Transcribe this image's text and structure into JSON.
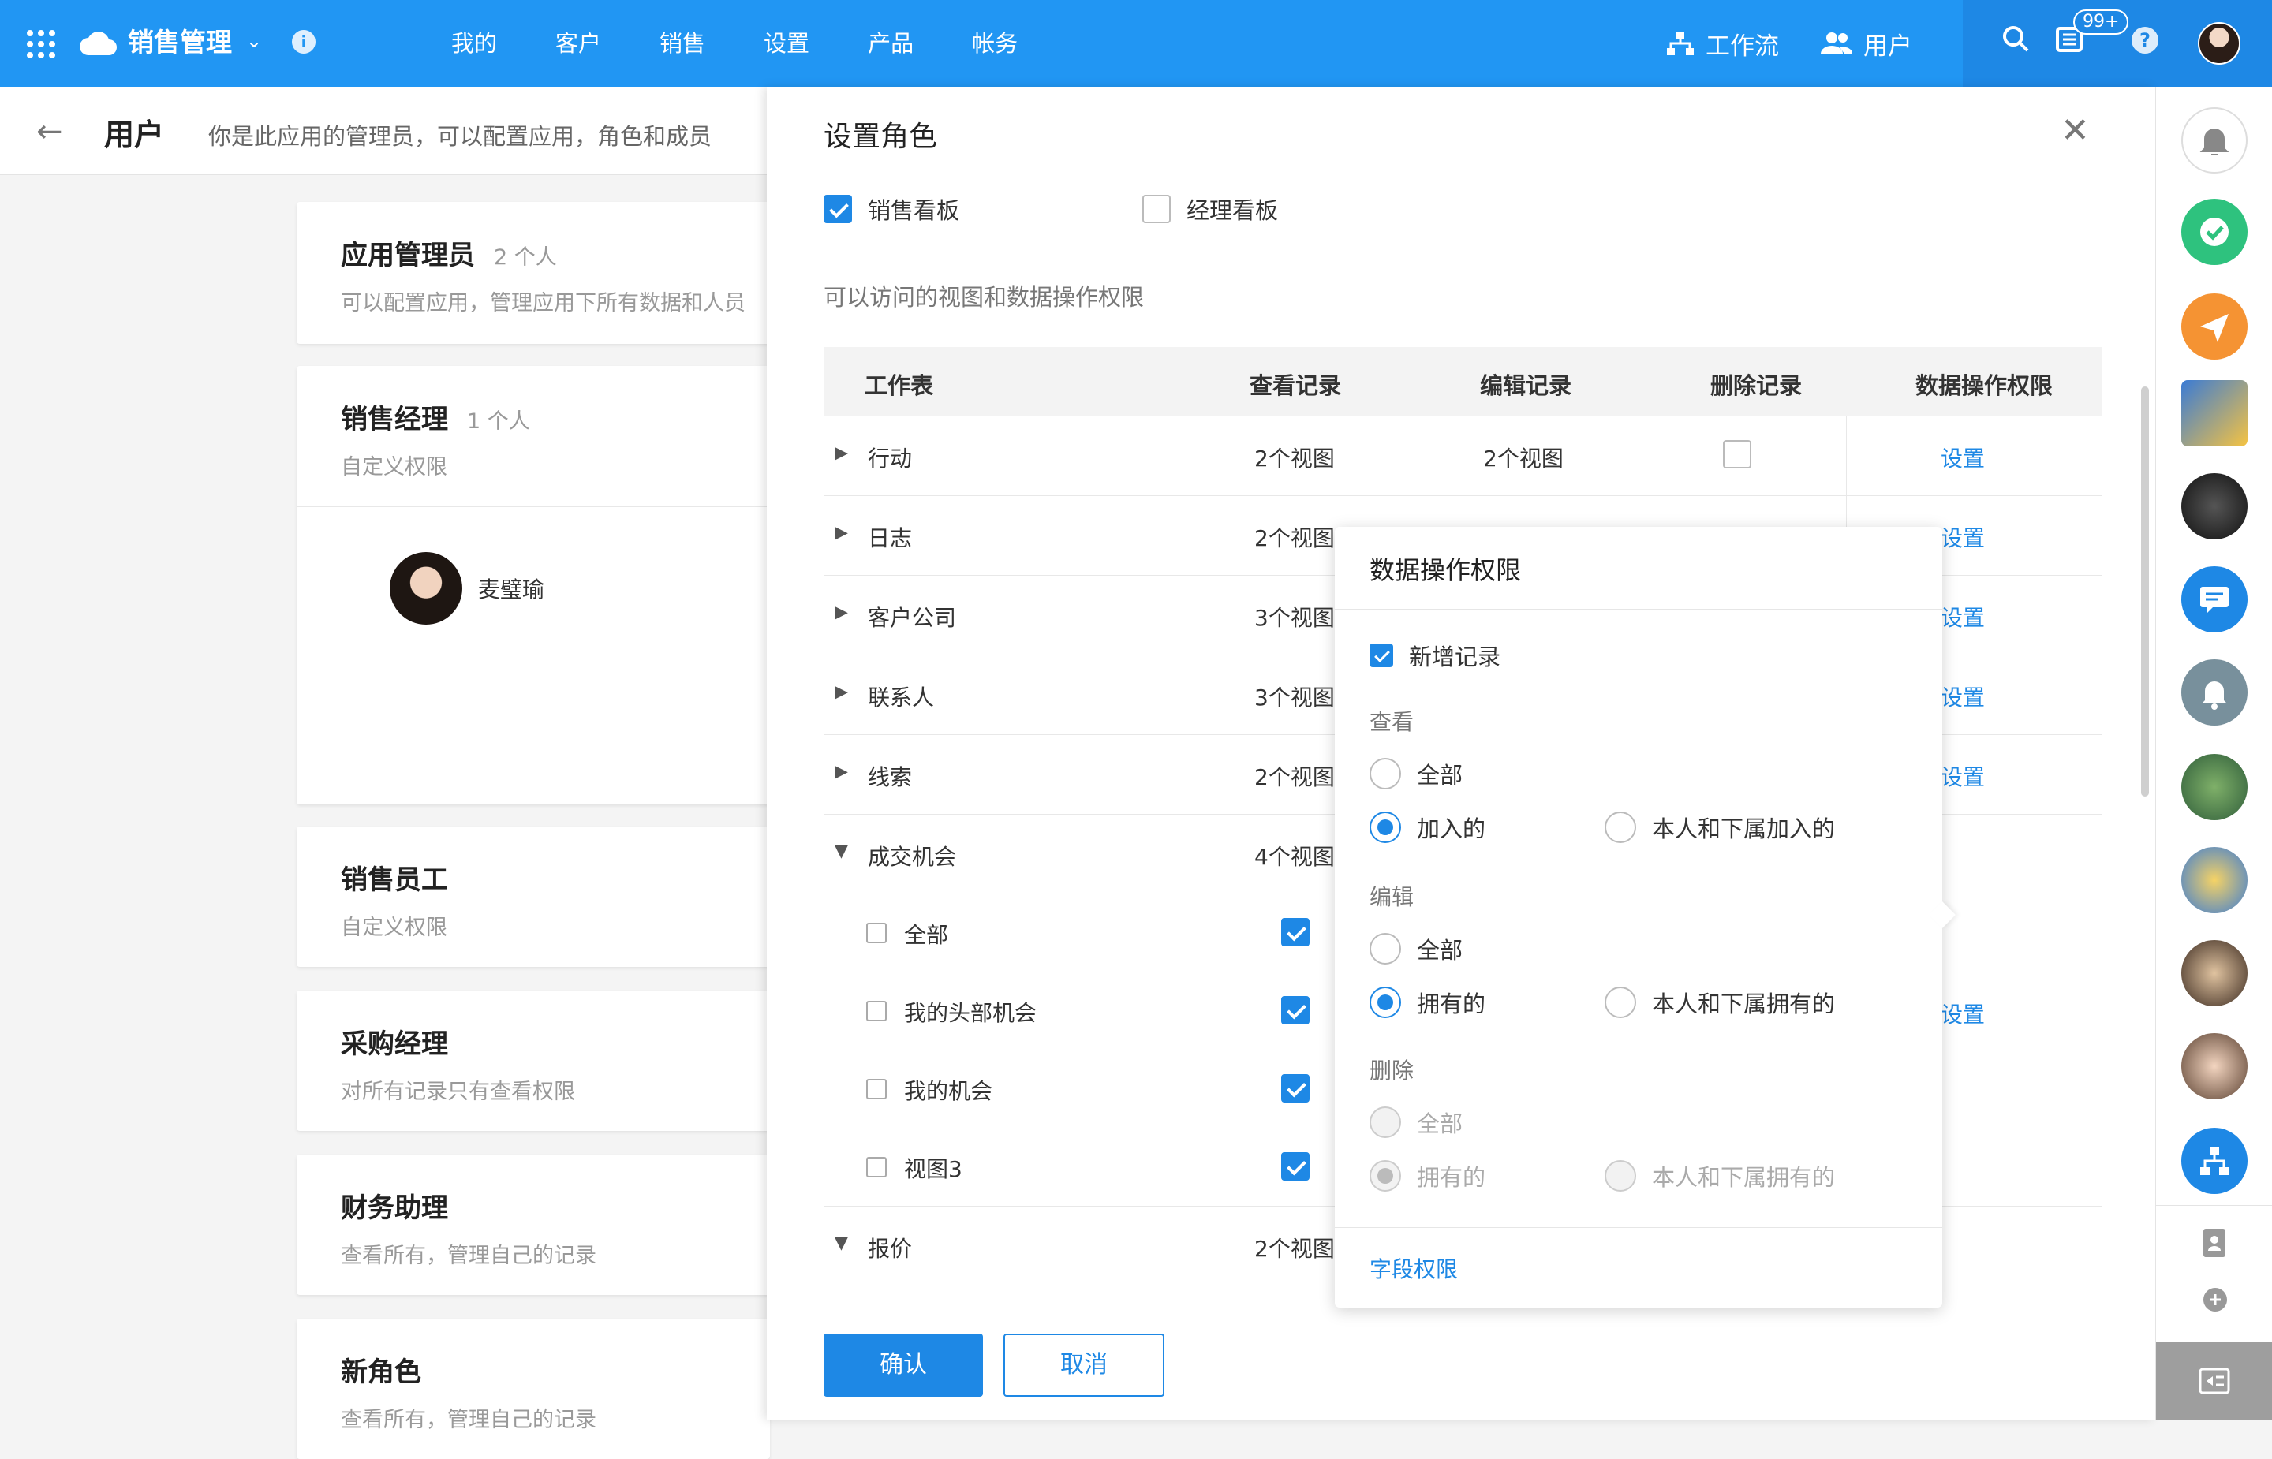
{
  "topbar": {
    "app_name": "销售管理",
    "nav": [
      "我的",
      "客户",
      "销售",
      "设置",
      "产品",
      "帐务"
    ],
    "workflow_label": "工作流",
    "users_label": "用户",
    "badge": "99+",
    "accent": "#2196f3"
  },
  "page": {
    "title": "用户",
    "description": "你是此应用的管理员，可以配置应用，角色和成员"
  },
  "roles": [
    {
      "name": "应用管理员",
      "count": "2 个人",
      "desc": "可以配置应用，管理应用下所有数据和人员"
    },
    {
      "name": "销售经理",
      "count": "1 个人",
      "desc": "自定义权限",
      "member": "麦璧瑜"
    },
    {
      "name": "销售员工",
      "count": "",
      "desc": "自定义权限"
    },
    {
      "name": "采购经理",
      "count": "",
      "desc": "对所有记录只有查看权限"
    },
    {
      "name": "财务助理",
      "count": "",
      "desc": "查看所有，管理自己的记录"
    },
    {
      "name": "新角色",
      "count": "",
      "desc": "查看所有，管理自己的记录"
    }
  ],
  "modal": {
    "title": "设置角色",
    "boards": [
      {
        "label": "销售看板",
        "checked": true
      },
      {
        "label": "经理看板",
        "checked": false
      }
    ],
    "section_label": "可以访问的视图和数据操作权限",
    "columns": [
      "工作表",
      "查看记录",
      "编辑记录",
      "删除记录",
      "数据操作权限"
    ],
    "rows": [
      {
        "name": "行动",
        "view": "2个视图",
        "edit": "2个视图",
        "link": "设置"
      },
      {
        "name": "日志",
        "view": "2个视图",
        "link": "设置"
      },
      {
        "name": "客户公司",
        "view": "3个视图",
        "link": "设置"
      },
      {
        "name": "联系人",
        "view": "3个视图",
        "link": "设置"
      },
      {
        "name": "线索",
        "view": "2个视图",
        "link": "设置"
      },
      {
        "name": "成交机会",
        "view": "4个视图"
      }
    ],
    "subviews": [
      {
        "name": "全部",
        "icon": "list-icon"
      },
      {
        "name": "我的头部机会",
        "icon": "table-icon",
        "link": "设置"
      },
      {
        "name": "我的机会",
        "icon": "table-icon"
      },
      {
        "name": "视图3",
        "icon": "board-icon"
      }
    ],
    "last_row": {
      "name": "报价",
      "view": "2个视图"
    },
    "confirm": "确认",
    "cancel": "取消"
  },
  "popover": {
    "title": "数据操作权限",
    "add_record": "新增记录",
    "view_group": "查看",
    "edit_group": "编辑",
    "delete_group": "删除",
    "opt_all": "全部",
    "opt_joined": "加入的",
    "opt_sub_joined": "本人和下属加入的",
    "opt_owned": "拥有的",
    "opt_sub_owned": "本人和下属拥有的",
    "field_link": "字段权限"
  }
}
